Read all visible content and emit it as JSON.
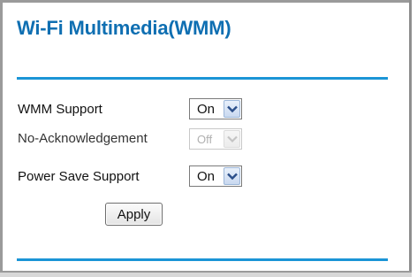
{
  "page": {
    "title": "Wi-Fi Multimedia(WMM)"
  },
  "settings": [
    {
      "label": "WMM Support",
      "value": "On",
      "enabled": true
    },
    {
      "label": "No-Acknowledgement",
      "value": "Off",
      "enabled": false
    },
    {
      "label": "Power Save Support",
      "value": "On",
      "enabled": true
    }
  ],
  "actions": {
    "apply_label": "Apply"
  },
  "icons": {
    "dropdown": "chevron-down-icon"
  },
  "colors": {
    "title": "#0f6fb2",
    "rule": "#1b95d6",
    "disabled_text": "#b0b0b0"
  }
}
